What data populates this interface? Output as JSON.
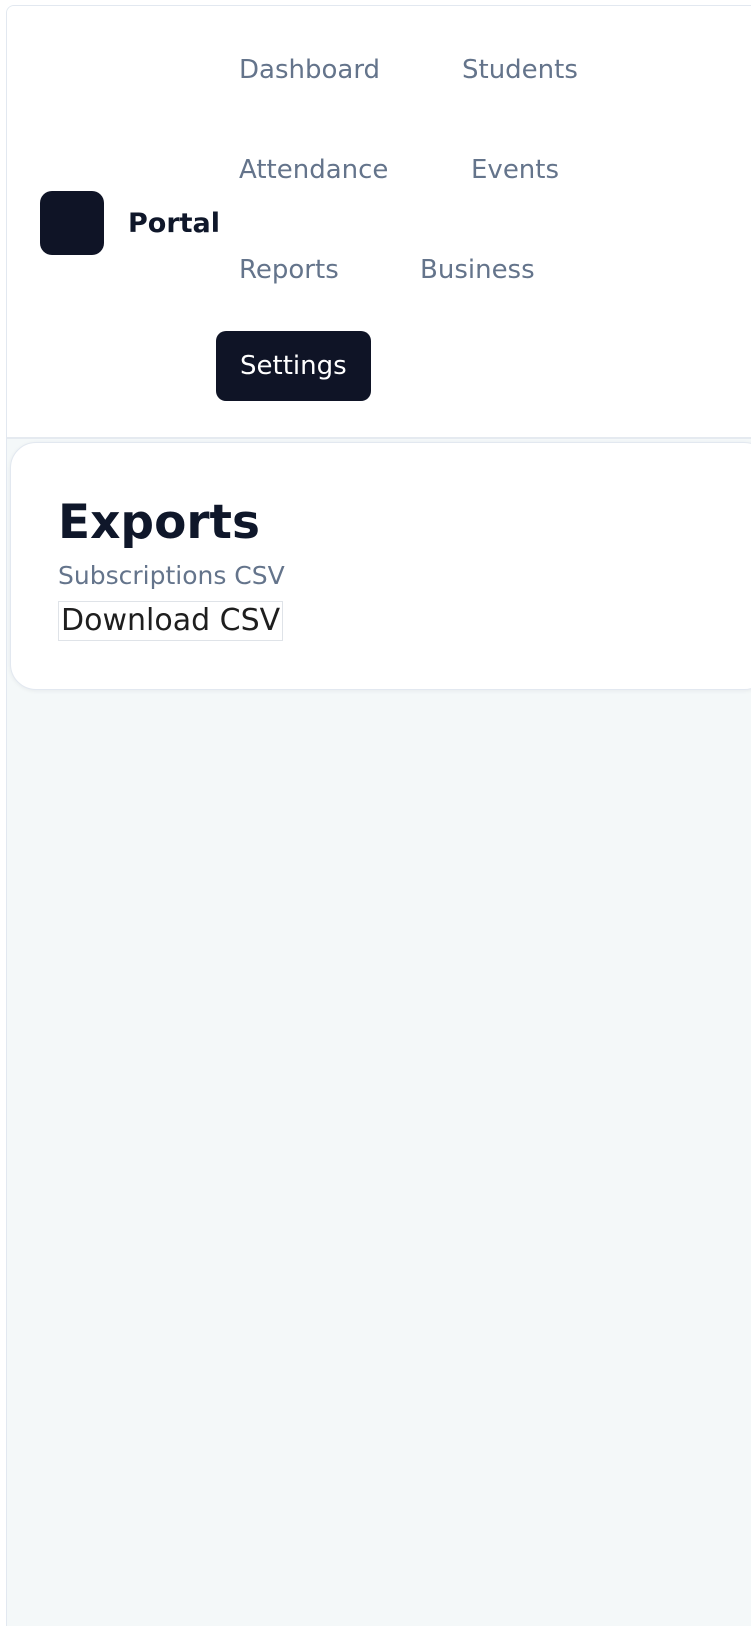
{
  "brand": {
    "name": "Portal"
  },
  "nav": {
    "items": [
      {
        "label": "Dashboard"
      },
      {
        "label": "Students"
      },
      {
        "label": "Attendance"
      },
      {
        "label": "Events"
      },
      {
        "label": "Reports"
      },
      {
        "label": "Business"
      },
      {
        "label": "Settings",
        "active": true
      }
    ]
  },
  "exports": {
    "title": "Exports",
    "subtitle": "Subscriptions CSV",
    "download_label": "Download CSV"
  },
  "colors": {
    "primary_dark": "#0f1426",
    "muted_text": "#64748b",
    "page_background": "#f4f8f9"
  }
}
